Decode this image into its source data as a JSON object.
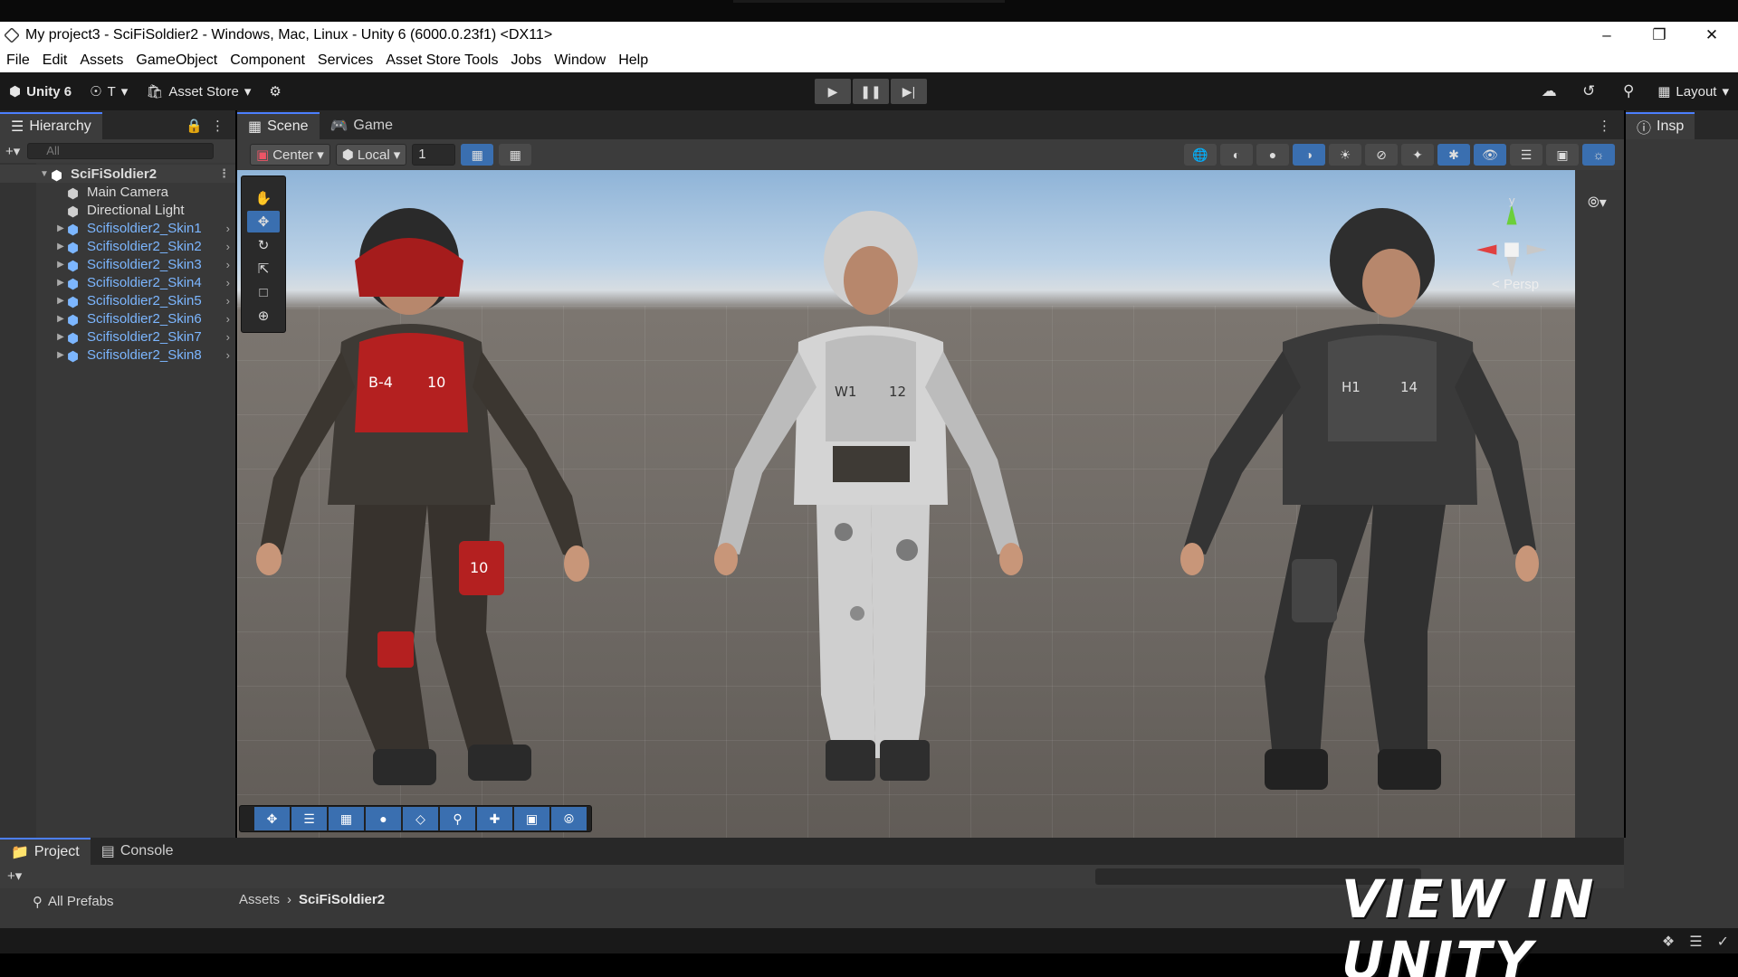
{
  "window": {
    "title": "My project3 - SciFiSoldier2 - Windows, Mac, Linux - Unity 6 (6000.0.23f1) <DX11>"
  },
  "menu": [
    "File",
    "Edit",
    "Assets",
    "GameObject",
    "Component",
    "Services",
    "Asset Store Tools",
    "Jobs",
    "Window",
    "Help"
  ],
  "toolbar": {
    "unity_label": "Unity 6",
    "account_label": "T",
    "asset_store_label": "Asset Store",
    "layout_label": "Layout"
  },
  "hierarchy": {
    "tab_label": "Hierarchy",
    "search_placeholder": "All",
    "root": "SciFiSoldier2",
    "items": [
      {
        "label": "Main Camera",
        "prefab": false
      },
      {
        "label": "Directional Light",
        "prefab": false
      },
      {
        "label": "Scifisoldier2_Skin1",
        "prefab": true
      },
      {
        "label": "Scifisoldier2_Skin2",
        "prefab": true
      },
      {
        "label": "Scifisoldier2_Skin3",
        "prefab": true
      },
      {
        "label": "Scifisoldier2_Skin4",
        "prefab": true
      },
      {
        "label": "Scifisoldier2_Skin5",
        "prefab": true
      },
      {
        "label": "Scifisoldier2_Skin6",
        "prefab": true
      },
      {
        "label": "Scifisoldier2_Skin7",
        "prefab": true
      },
      {
        "label": "Scifisoldier2_Skin8",
        "prefab": true
      }
    ]
  },
  "scene": {
    "tabs": [
      {
        "label": "Scene",
        "icon": "grid-icon"
      },
      {
        "label": "Game",
        "icon": "gamepad-icon"
      }
    ],
    "pivot_label": "Center",
    "space_label": "Local",
    "grid_value": "1",
    "persp_label": "Persp",
    "gizmo_axis_y": "y"
  },
  "inspector": {
    "tab_label": "Insp"
  },
  "bottom": {
    "tabs": [
      "Project",
      "Console"
    ],
    "favorite": "All Prefabs",
    "breadcrumb": [
      "Assets",
      "SciFiSoldier2"
    ]
  },
  "watermark": "VIEW IN UNITY",
  "colors": {
    "accent_blue": "#3a6fb0",
    "prefab_blue": "#7cb6ff",
    "soldier_red": "#b42020",
    "soldier_camo": "#c8c8c8",
    "soldier_black": "#3a3a3a"
  }
}
